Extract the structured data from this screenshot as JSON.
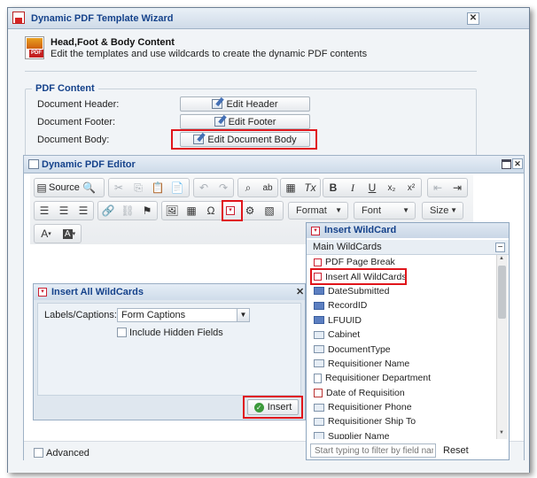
{
  "wizard": {
    "title": "Dynamic PDF Template Wizard",
    "heading": "Head,Foot & Body Content",
    "subheading": "Edit the templates and use wildcards to create the dynamic PDF contents",
    "section_title": "PDF Content",
    "rows": [
      {
        "label": "Document Header:",
        "button": "Edit Header"
      },
      {
        "label": "Document Footer:",
        "button": "Edit Footer"
      },
      {
        "label": "Document Body:",
        "button": "Edit Document Body"
      }
    ],
    "advanced_label": "Advanced"
  },
  "editor": {
    "title": "Dynamic PDF Editor",
    "source_label": "Source",
    "format_combo": "Format",
    "font_combo": "Font",
    "size_combo": "Size"
  },
  "insert_all_dialog": {
    "title": "Insert All WildCards",
    "labels_label": "Labels/Captions:",
    "labels_value": "Form Captions",
    "hidden_label": "Include Hidden Fields",
    "insert_label": "Insert"
  },
  "wildcard_panel": {
    "title": "Insert WildCard",
    "group_label": "Main WildCards",
    "items": [
      {
        "label": "PDF Page Break",
        "icon": "red"
      },
      {
        "label": "Insert All WildCards",
        "icon": "red"
      },
      {
        "label": "DateSubmitted",
        "icon": "dyn"
      },
      {
        "label": "RecordID",
        "icon": "dyn"
      },
      {
        "label": "LFUUID",
        "icon": "dyn"
      },
      {
        "label": "Cabinet",
        "icon": "field"
      },
      {
        "label": "DocumentType",
        "icon": "field"
      },
      {
        "label": "Requisitioner Name",
        "icon": "field"
      },
      {
        "label": "Requisitioner Department",
        "icon": "doc"
      },
      {
        "label": "Date of Requisition",
        "icon": "cal"
      },
      {
        "label": "Requisitioner Phone",
        "icon": "field"
      },
      {
        "label": "Requisitioner Ship To",
        "icon": "field"
      },
      {
        "label": "Supplier Name",
        "icon": "field"
      }
    ],
    "filter_placeholder": "Start typing to filter by field name",
    "reset_label": "Reset"
  },
  "colors": {
    "title_text": "#15428b",
    "highlight_red": "#e0151b"
  }
}
